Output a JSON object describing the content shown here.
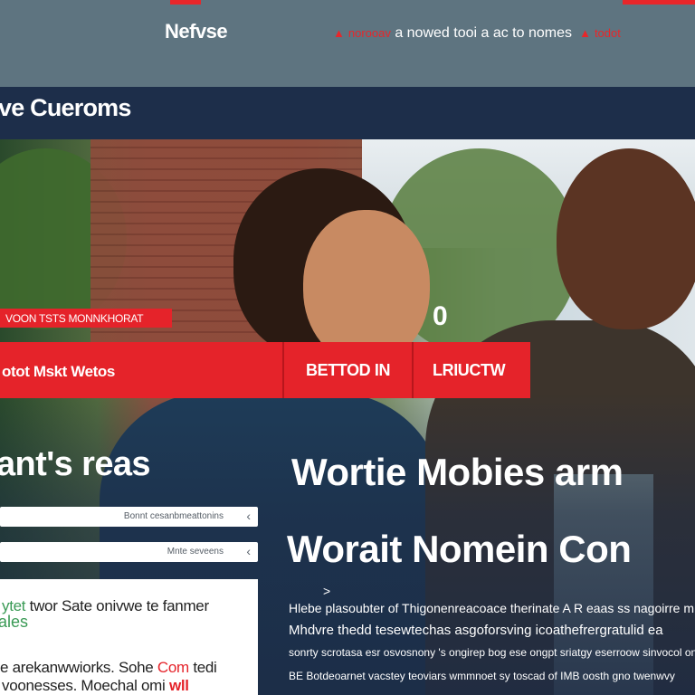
{
  "header": {
    "brand": "Nefvse",
    "ticker_tag": "norooav",
    "ticker_text": "a nowed tooi a ac to nomes",
    "ticker_tag2": "todot"
  },
  "nav": {
    "title": "ve Cueroms"
  },
  "hero": {
    "tag": "VOON TSTS MONNKHORAT",
    "number": "0",
    "bar": {
      "label": "otot Mskt Wetos",
      "button1": "BETTOD IN",
      "button2": "LRIUCTW"
    },
    "headline_left": "ant's reas",
    "headline_right_1": "Wortie Mobies arm",
    "headline_right_2": "Worait Nomein Con"
  },
  "form": {
    "field1_placeholder": "Bonnt cesanbmeattonins",
    "field2_placeholder": "Mnte seveens"
  },
  "card": {
    "line1_a": "ytet",
    "line1_b": "twor Sate onivwe te fanmer",
    "line2": "ales",
    "line3_a": "e arekanwwiorks. Sohe",
    "line3_b": "Com",
    "line3_c": "tedi",
    "line4_a": "voonesses. Moechal omi",
    "line4_b": "wll"
  },
  "article": {
    "arrow": ">",
    "line1": "Hlebe plasoubter of Thigonenreacoace therinate A R eaas ss nagoirre m Rlb",
    "line2": "Mhdvre thedd tesewtechas asgoforsving icoathefrergratulid ea",
    "line3": "sonrty scrotasa esr osvosnony 's ongirep bog ese ongpt sriatgy eserroow sinvocol onli",
    "line4": "BE Botdeoarnet vacstey teoviars wmmnoet sy toscad of IMB oosth gno twenwvy"
  }
}
